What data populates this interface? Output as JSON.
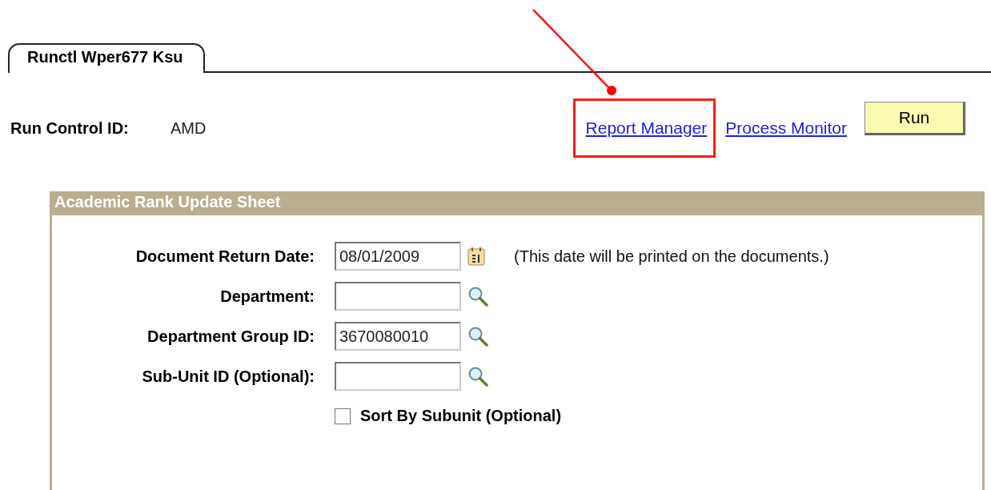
{
  "tabs": [
    {
      "label": "Runctl Wper677 Ksu",
      "selected": true
    }
  ],
  "run_control": {
    "label": "Run Control ID:",
    "value": "AMD"
  },
  "links": [
    {
      "label": "Report Manager",
      "highlighted": true
    },
    {
      "label": "Process Monitor",
      "highlighted": false
    }
  ],
  "run_button": {
    "label": "Run"
  },
  "panel": {
    "title": "Academic Rank Update Sheet",
    "fields": [
      {
        "kind": "date",
        "label": "Document Return Date:",
        "value": "08/01/2009",
        "note": "(This date will be printed on the documents.)"
      },
      {
        "kind": "lookup",
        "label": "Department:"
      },
      {
        "kind": "lookup",
        "label": "Department Group ID:",
        "value": "3670080010"
      },
      {
        "kind": "lookup",
        "label": "Sub-Unit ID (Optional):"
      }
    ],
    "checkbox": {
      "label": "Sort By Subunit (Optional)",
      "checked": false
    }
  }
}
